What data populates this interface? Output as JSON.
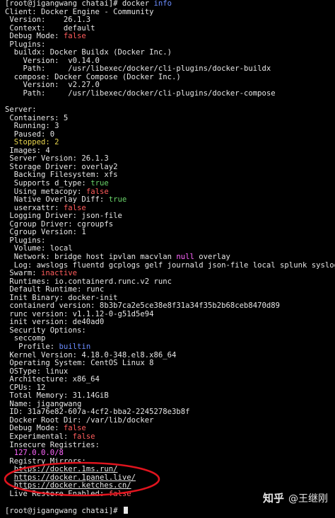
{
  "prompt": {
    "text": "[root@jigangwang chatai]# ",
    "command": "docker ",
    "arg": "info"
  },
  "lines": {
    "client": "Client: Docker Engine - Community",
    "version": " Version:    26.1.3",
    "context": " Context:    default",
    "debug_label": " Debug Mode: ",
    "debug_val": "false",
    "plugins": " Plugins:",
    "buildx": "  buildx: Docker Buildx (Docker Inc.)",
    "buildx_ver": "    Version:  v0.14.0",
    "buildx_path": "    Path:     /usr/libexec/docker/cli-plugins/docker-buildx",
    "compose": "  compose: Docker Compose (Docker Inc.)",
    "compose_ver": "    Version:  v2.27.0",
    "compose_path": "    Path:     /usr/libexec/docker/cli-plugins/docker-compose",
    "server": "Server:",
    "containers": " Containers: 5",
    "running": "  Running: 3",
    "paused": "  Paused: 0",
    "stopped": "  Stopped: 2",
    "images": " Images: 4",
    "server_version": " Server Version: 26.1.3",
    "storage_driver": " Storage Driver: overlay2",
    "backing_fs": "  Backing Filesystem: xfs",
    "dtype_label": "  Supports d_type: ",
    "dtype_val": "true",
    "metacopy_label": "  Using metacopy: ",
    "metacopy_val": "false",
    "native_label": "  Native Overlay Diff: ",
    "native_val": "true",
    "userxattr_label": "  userxattr: ",
    "userxattr_val": "false",
    "logging_driver": " Logging Driver: json-file",
    "cgroup_driver": " Cgroup Driver: cgroupfs",
    "cgroup_version": " Cgroup Version: 1",
    "plugins2": " Plugins:",
    "volume": "  Volume: local",
    "network_a": "  Network: bridge host ipvlan macvlan ",
    "network_null": "null",
    "network_b": " overlay",
    "log": "  Log: awslogs fluentd gcplogs gelf journald json-file local splunk syslog",
    "swarm_label": " Swarm: ",
    "swarm_val": "inactive",
    "runtimes": " Runtimes: io.containerd.runc.v2 runc",
    "default_runtime": " Default Runtime: runc",
    "init_binary": " Init Binary: docker-init",
    "containerd_version": " containerd version: 8b3b7ca2e5ce38e8f31a34f35b2b68ceb8470d89",
    "runc_version": " runc version: v1.1.12-0-g51d5e94",
    "init_version": " init version: de40ad0",
    "security_options": " Security Options:",
    "seccomp": "  seccomp",
    "profile_label": "   Profile: ",
    "profile_val": "builtin",
    "kernel": " Kernel Version: 4.18.0-348.el8.x86_64",
    "os": " Operating System: CentOS Linux 8",
    "ostype": " OSType: linux",
    "arch": " Architecture: x86_64",
    "cpus": " CPUs: 12",
    "memory": " Total Memory: 31.14GiB",
    "name": " Name: jigangwang",
    "id": " ID: 31a76e82-607a-4cf2-bba2-2245278e3b8f",
    "root_dir": " Docker Root Dir: /var/lib/docker",
    "debug2_label": " Debug Mode: ",
    "debug2_val": "false",
    "experimental_label": " Experimental: ",
    "experimental_val": "false",
    "insecure": " Insecure Registries:",
    "insecure_val": "  127.0.0.0/8",
    "mirrors": " Registry Mirrors:",
    "mirror1": "https://docker.1ms.run/",
    "mirror2": "https://docker.1panel.live/",
    "mirror3": "https://docker.ketches.cn/",
    "live_restore_label": " Live Restore Enabled: ",
    "live_restore_val": "false"
  },
  "prompt2": {
    "text": "[root@jigangwang chatai]# "
  },
  "watermark": {
    "logo": "知乎",
    "author": "@王继刚"
  },
  "colors": {
    "background": "#000000",
    "text": "#e6e6e6",
    "keyword_blue": "#6b8cff",
    "false_red": "#ff5c5c",
    "true_green": "#6bd66b",
    "stopped_yellow": "#e8d44d",
    "ip_magenta": "#ff66ff",
    "annotation_red": "#e0141e"
  }
}
